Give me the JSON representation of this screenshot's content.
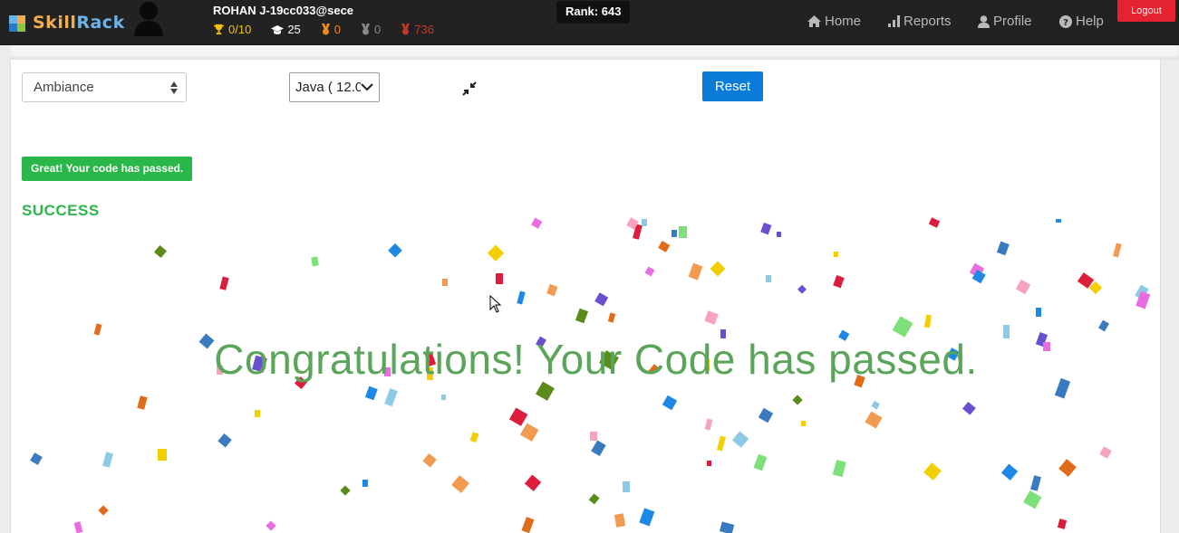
{
  "app": {
    "brand_part1": "Skill",
    "brand_part2": "Rack"
  },
  "header": {
    "user_name": "ROHAN J-19cc033@sece",
    "stats": {
      "trophies": "0/10",
      "certificates": "25",
      "gold_medals": "0",
      "silver_medals": "0",
      "points": "736"
    },
    "rank": "Rank: 643",
    "nav": {
      "home": "Home",
      "reports": "Reports",
      "profile": "Profile",
      "help": "Help"
    },
    "logout": "Logout"
  },
  "editor": {
    "theme_value": "Ambiance",
    "language_value": "Java ( 12.0",
    "reset_label": "Reset"
  },
  "result": {
    "badge": "Great! Your code has passed.",
    "status": "SUCCESS",
    "congrats": "Congratulations! Your Code has passed."
  },
  "colors": {
    "navbar": "#222222",
    "success_green": "#2ab74a",
    "congrats_green": "#5aa55a",
    "reset_blue": "#0a7bd9",
    "logout_red": "#e52230"
  },
  "icons": {
    "trophy": "trophy-icon",
    "certificate": "graduation-cap-icon",
    "gold": "gold-medal-icon",
    "silver": "silver-medal-icon",
    "points": "points-icon",
    "home": "home-icon",
    "reports": "bar-chart-icon",
    "profile": "user-icon",
    "help": "question-circle-icon",
    "compress": "compress-icon"
  }
}
